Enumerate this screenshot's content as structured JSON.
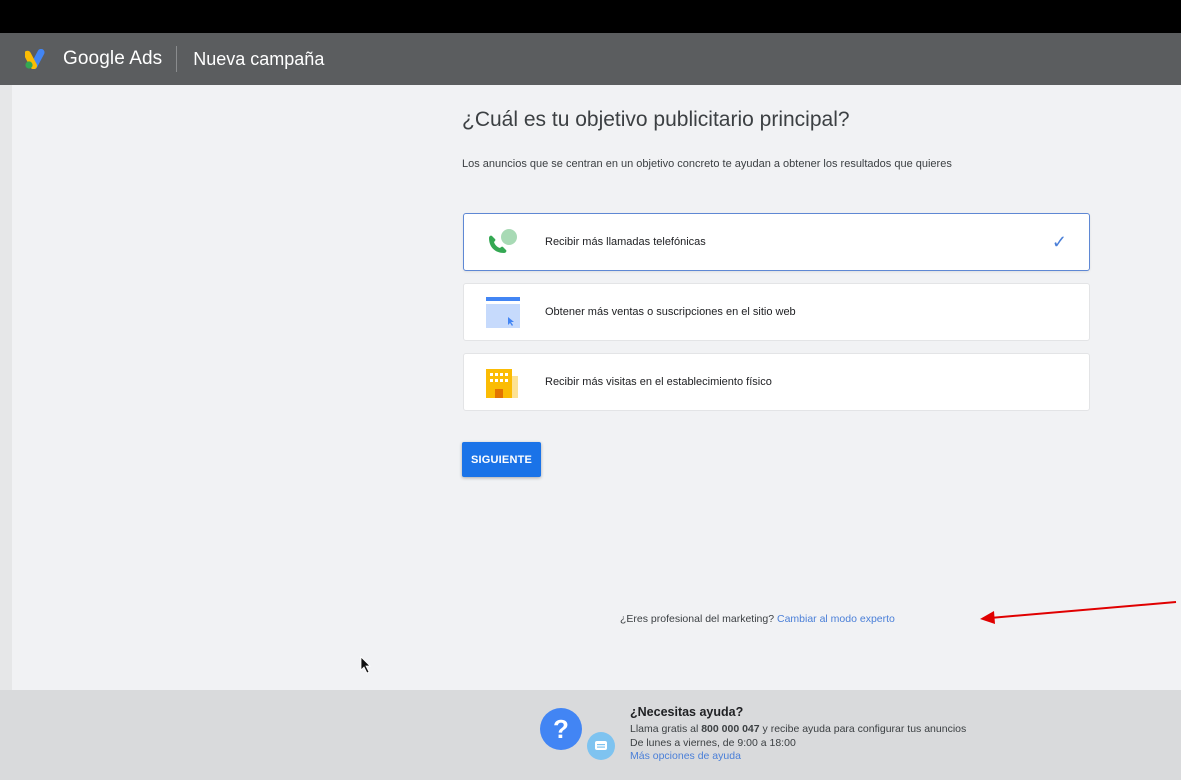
{
  "header": {
    "brand": "Google Ads",
    "title": "Nueva campaña"
  },
  "main": {
    "question": "¿Cuál es tu objetivo publicitario principal?",
    "subtitle": "Los anuncios que se centran en un objetivo concreto te ayudan a obtener los resultados que quieres",
    "options": [
      {
        "label": "Recibir más llamadas telefónicas",
        "icon": "phone-icon",
        "selected": true
      },
      {
        "label": "Obtener más ventas o suscripciones en el sitio web",
        "icon": "browser-window-icon",
        "selected": false
      },
      {
        "label": "Recibir más visitas en el establecimiento físico",
        "icon": "store-building-icon",
        "selected": false
      }
    ],
    "next_button": "SIGUIENTE",
    "pro_question": "¿Eres profesional del marketing?",
    "pro_link": "Cambiar al modo experto",
    "check_glyph": "✓"
  },
  "help": {
    "title": "¿Necesitas ayuda?",
    "line1_pre": "Llama gratis al",
    "phone": "800 000 047",
    "line1_post": "y recibe ayuda para configurar tus anuncios",
    "line2": "De lunes a viernes, de 9:00 a 18:00",
    "link": "Más opciones de ayuda",
    "question_glyph": "?"
  },
  "colors": {
    "accent": "#1a73e8",
    "header": "#5b5d5f",
    "annotation_arrow": "#e00000"
  }
}
